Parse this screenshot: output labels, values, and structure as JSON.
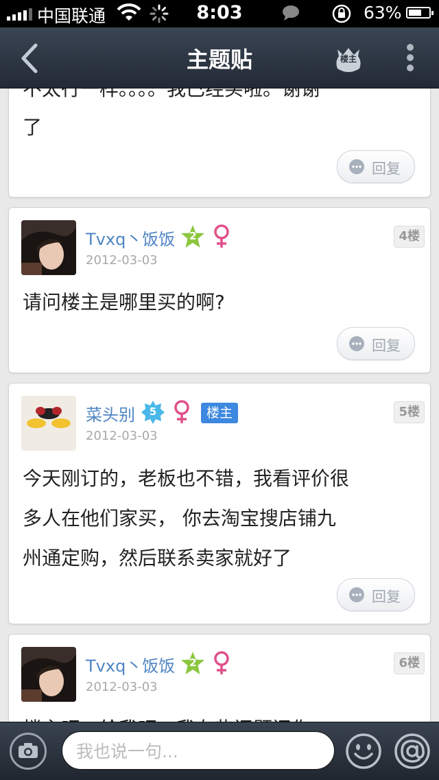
{
  "status_bar": {
    "carrier": "中国联通",
    "time": "8:03",
    "battery_percent": "63%",
    "battery_level": 0.63
  },
  "nav": {
    "title": "主题贴",
    "owner_label": "楼主",
    "back_icon": "chevron-left-icon",
    "more_icon": "more-vertical-icon"
  },
  "posts": [
    {
      "text_line1": "不太行一样。。。。我已经买啦。谢谢",
      "text_line2": "了",
      "reply_label": "回复"
    },
    {
      "username": "Tvxq丶饭饭",
      "level": "2",
      "gender": "♀",
      "date": "2012-03-03",
      "floor": "4楼",
      "text": "请问楼主是哪里买的啊?",
      "reply_label": "回复"
    },
    {
      "username": "菜头别",
      "level": "5",
      "gender": "♀",
      "owner_badge": "楼主",
      "date": "2012-03-03",
      "floor": "5楼",
      "text_lines": [
        "今天刚订的，老板也不错，我看评价很",
        "多人在他们家买， 你去淘宝搜店铺九",
        "州通定购，然后联系卖家就好了"
      ],
      "reply_label": "回复"
    },
    {
      "username": "Tvxq丶饭饭",
      "level": "2",
      "gender": "♀",
      "date": "2012-03-03",
      "floor": "6楼",
      "text": "楼主吧，给我吧，我有些问题问你"
    }
  ],
  "input": {
    "placeholder": "我也说一句..."
  },
  "colors": {
    "username": "#4f85c4",
    "owner_badge": "#3d88e0",
    "level2_star": "#8cc63f",
    "level5_star": "#4ab8e8",
    "female": "#e0508a"
  }
}
